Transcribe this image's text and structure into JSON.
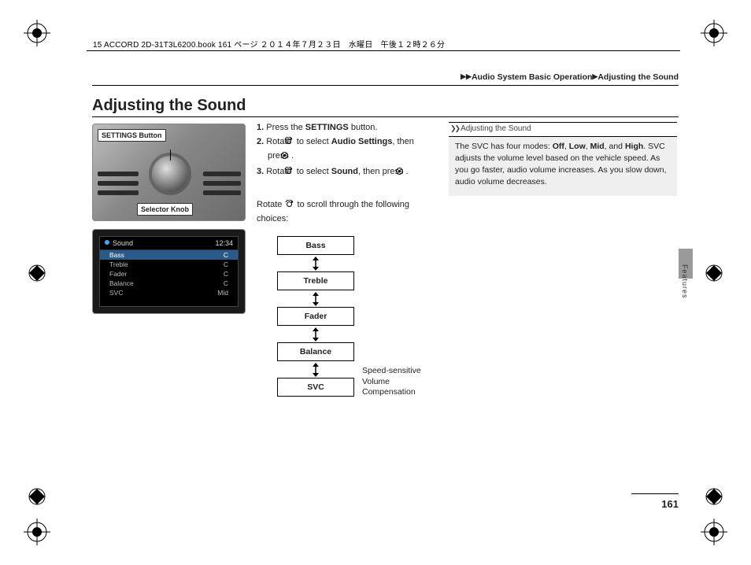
{
  "doc_header": "15 ACCORD 2D-31T3L6200.book  161 ページ  ２０１４年７月２３日　水曜日　午後１２時２６分",
  "breadcrumb": {
    "a": "Audio System Basic Operation",
    "b": "Adjusting the Sound"
  },
  "title": "Adjusting the Sound",
  "callouts": {
    "settings": "SETTINGS Button",
    "knob": "Selector Knob"
  },
  "screen": {
    "title": "Sound",
    "clock": "12:34",
    "rows": [
      {
        "label": "Bass",
        "val": "C"
      },
      {
        "label": "Treble",
        "val": "C"
      },
      {
        "label": "Fader",
        "val": "C"
      },
      {
        "label": "Balance",
        "val": "C"
      },
      {
        "label": "SVC",
        "val": "Mid"
      }
    ]
  },
  "steps": {
    "s1_pre": "Press the ",
    "s1_b": "SETTINGS",
    "s1_post": " button.",
    "s2_pre": "Rotate ",
    "s2_mid": " to select ",
    "s2_b": "Audio Settings",
    "s2_post": ", then press ",
    "s3_pre": "Rotate ",
    "s3_mid": " to select ",
    "s3_b": "Sound",
    "s3_post": ", then press ",
    "after": "Rotate  to scroll through the following choices:"
  },
  "after_pre": "Rotate ",
  "after_post": " to scroll through the following choices:",
  "flow": [
    "Bass",
    "Treble",
    "Fader",
    "Balance",
    "SVC"
  ],
  "svc_note": "Speed-sensitive Volume Compensation",
  "sidebar": {
    "head": "Adjusting the Sound",
    "body_pre": "The SVC has four modes: ",
    "m1": "Off",
    "m2": "Low",
    "m3": "Mid",
    "m4": "High",
    "body_post": ". SVC adjusts the volume level based on the vehicle speed. As you go faster, audio volume increases. As you slow down, audio volume decreases."
  },
  "tab": "Features",
  "page": "161"
}
